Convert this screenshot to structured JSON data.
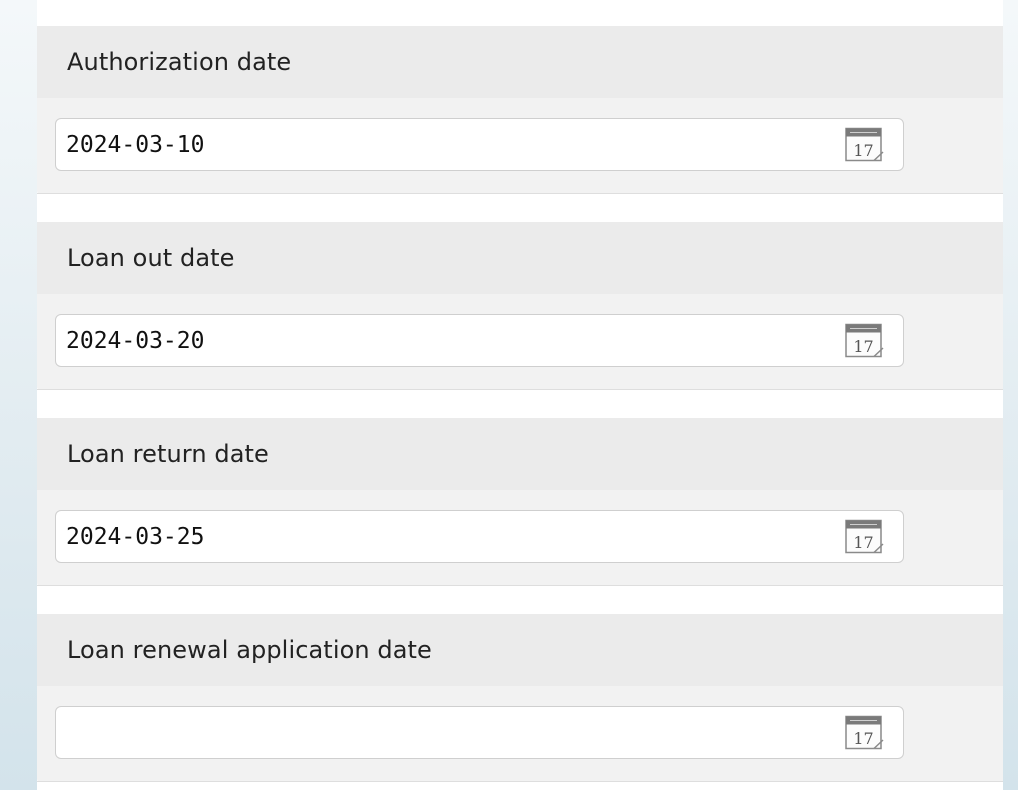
{
  "fields": [
    {
      "label": "Authorization date",
      "value": "2024-03-10",
      "calendar_day": "17"
    },
    {
      "label": "Loan out date",
      "value": "2024-03-20",
      "calendar_day": "17"
    },
    {
      "label": "Loan return date",
      "value": "2024-03-25",
      "calendar_day": "17"
    },
    {
      "label": "Loan renewal application date",
      "value": "",
      "calendar_day": "17"
    }
  ]
}
